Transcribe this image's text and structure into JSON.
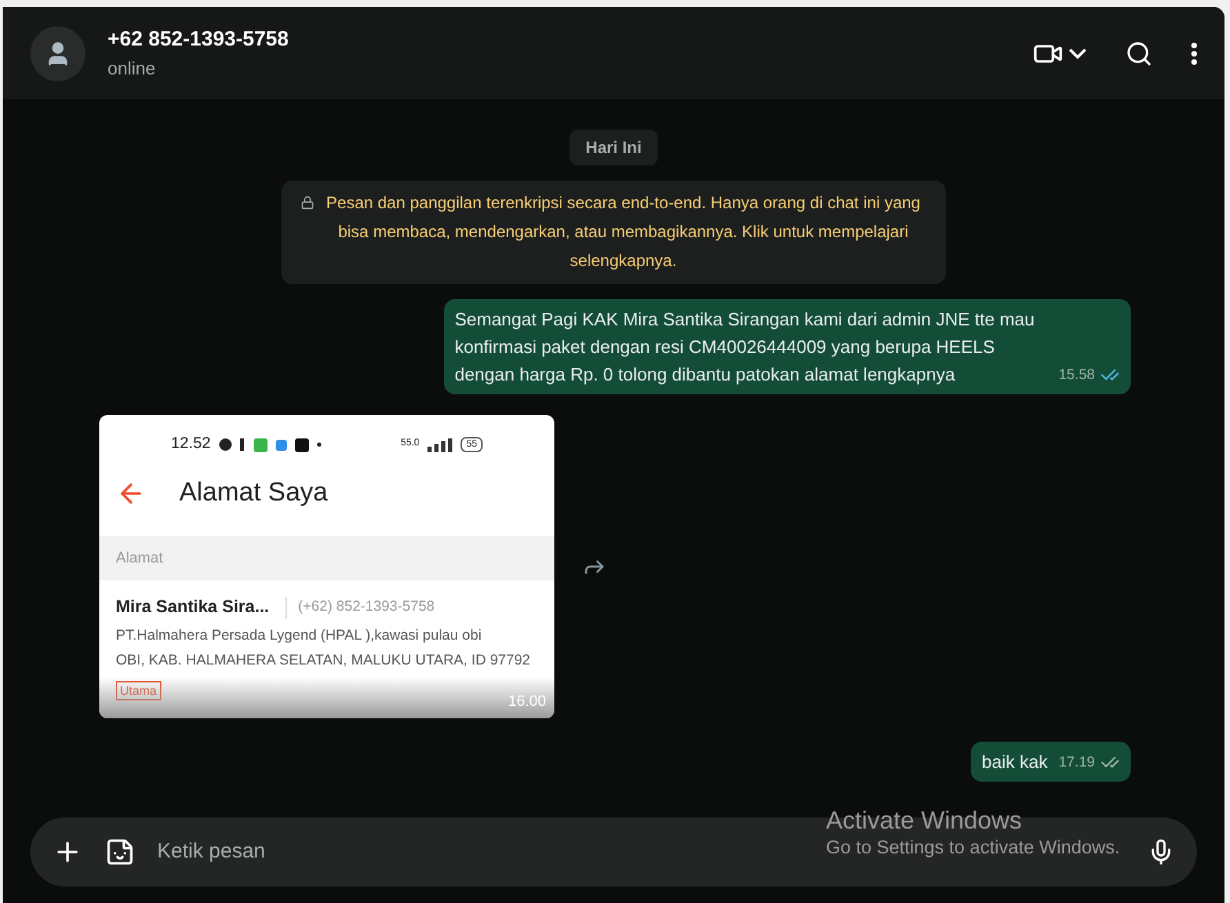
{
  "header": {
    "name": "+62 852-1393-5758",
    "status": "online"
  },
  "messages": [
    {
      "kind": "date",
      "text": "Hari Ini"
    },
    {
      "kind": "system",
      "text": "Pesan dan panggilan terenkripsi secara end-to-end. Hanya orang di chat ini yang bisa membaca, mendengarkan, atau membagikannya. Klik untuk mempelajari selengkapnya."
    },
    {
      "kind": "text",
      "text": "Semangat Pagi KAK Mira Santika Sirangan kami dari admin JNE tte mau konfirmasi paket dengan resi CM40026444009 yang berupa HEELS dengan harga Rp. 0 tolong dibantu patokan alamat lengkapnya",
      "time": "15.58",
      "read": true
    },
    {
      "kind": "image",
      "time": "16.00",
      "shot": {
        "clock": "12.52",
        "speed": "55.0",
        "battery": "55",
        "title": "Alamat Saya",
        "section": "Alamat",
        "name": "Mira Santika Sira...",
        "phone": "(+62) 852-1393-5758",
        "address_1": "PT.Halmahera Persada Lygend (HPAL ),kawasi pulau obi",
        "address_2": "OBI, KAB. HALMAHERA SELATAN, MALUKU UTARA, ID 97792",
        "tag": "Utama"
      }
    },
    {
      "kind": "text",
      "text": "baik kak",
      "time": "17.19",
      "read": false
    }
  ],
  "composer": {
    "placeholder": "Ketik pesan"
  },
  "os_overlay": {
    "title": "Activate Windows",
    "subtitle": "Go to Settings to activate Windows."
  }
}
